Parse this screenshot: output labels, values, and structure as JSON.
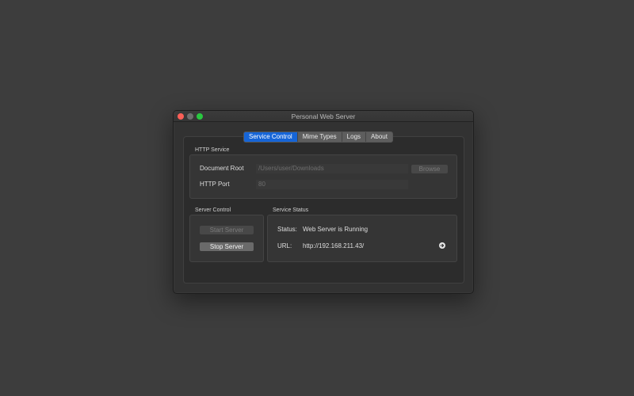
{
  "window": {
    "title": "Personal Web Server"
  },
  "tabs": [
    {
      "label": "Service Control",
      "active": true
    },
    {
      "label": "Mime Types",
      "active": false
    },
    {
      "label": "Logs",
      "active": false
    },
    {
      "label": "About",
      "active": false
    }
  ],
  "http_service": {
    "title": "HTTP Service",
    "document_root_label": "Document Root",
    "document_root_value": "/Users/user/Downloads",
    "browse_label": "Browse",
    "port_label": "HTTP Port",
    "port_value": "80"
  },
  "server_control": {
    "title": "Server Control",
    "start_label": "Start Server",
    "stop_label": "Stop Server"
  },
  "service_status": {
    "title": "Service Status",
    "status_label": "Status:",
    "status_value": "Web Server is Running",
    "url_label": "URL:",
    "url_value": "http://192.168.211.43/"
  },
  "colors": {
    "accent": "#1665d7",
    "close": "#fc5f57",
    "minimize": "#6e6e6e",
    "zoom": "#29c840"
  },
  "icons": {
    "open_url": "arrow-right-circle-icon"
  }
}
